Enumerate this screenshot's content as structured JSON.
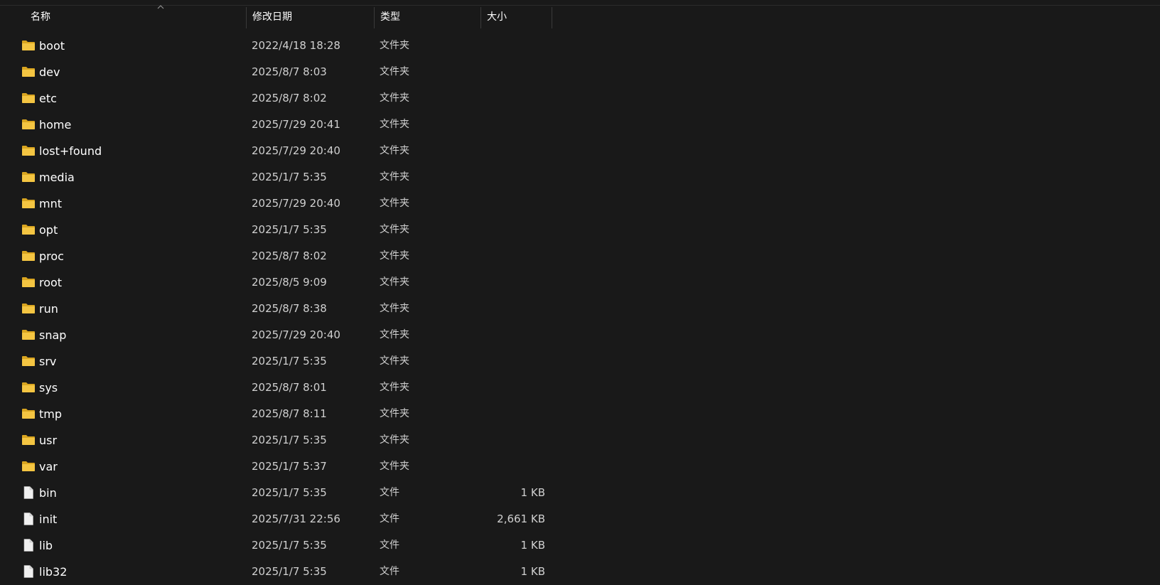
{
  "header": {
    "columns": [
      {
        "label": "名称",
        "sorted": "ascending"
      },
      {
        "label": "修改日期"
      },
      {
        "label": "类型"
      },
      {
        "label": "大小"
      }
    ]
  },
  "items": [
    {
      "name": "boot",
      "date": "2022/4/18 18:28",
      "type": "文件夹",
      "size": "",
      "icon": "folder-icon"
    },
    {
      "name": "dev",
      "date": "2025/8/7 8:03",
      "type": "文件夹",
      "size": "",
      "icon": "folder-icon"
    },
    {
      "name": "etc",
      "date": "2025/8/7 8:02",
      "type": "文件夹",
      "size": "",
      "icon": "folder-icon"
    },
    {
      "name": "home",
      "date": "2025/7/29 20:41",
      "type": "文件夹",
      "size": "",
      "icon": "folder-icon"
    },
    {
      "name": "lost+found",
      "date": "2025/7/29 20:40",
      "type": "文件夹",
      "size": "",
      "icon": "folder-icon"
    },
    {
      "name": "media",
      "date": "2025/1/7 5:35",
      "type": "文件夹",
      "size": "",
      "icon": "folder-icon"
    },
    {
      "name": "mnt",
      "date": "2025/7/29 20:40",
      "type": "文件夹",
      "size": "",
      "icon": "folder-icon"
    },
    {
      "name": "opt",
      "date": "2025/1/7 5:35",
      "type": "文件夹",
      "size": "",
      "icon": "folder-icon"
    },
    {
      "name": "proc",
      "date": "2025/8/7 8:02",
      "type": "文件夹",
      "size": "",
      "icon": "folder-icon"
    },
    {
      "name": "root",
      "date": "2025/8/5 9:09",
      "type": "文件夹",
      "size": "",
      "icon": "folder-icon"
    },
    {
      "name": "run",
      "date": "2025/8/7 8:38",
      "type": "文件夹",
      "size": "",
      "icon": "folder-icon"
    },
    {
      "name": "snap",
      "date": "2025/7/29 20:40",
      "type": "文件夹",
      "size": "",
      "icon": "folder-icon"
    },
    {
      "name": "srv",
      "date": "2025/1/7 5:35",
      "type": "文件夹",
      "size": "",
      "icon": "folder-icon"
    },
    {
      "name": "sys",
      "date": "2025/8/7 8:01",
      "type": "文件夹",
      "size": "",
      "icon": "folder-icon"
    },
    {
      "name": "tmp",
      "date": "2025/8/7 8:11",
      "type": "文件夹",
      "size": "",
      "icon": "folder-icon"
    },
    {
      "name": "usr",
      "date": "2025/1/7 5:35",
      "type": "文件夹",
      "size": "",
      "icon": "folder-icon"
    },
    {
      "name": "var",
      "date": "2025/1/7 5:37",
      "type": "文件夹",
      "size": "",
      "icon": "folder-icon"
    },
    {
      "name": "bin",
      "date": "2025/1/7 5:35",
      "type": "文件",
      "size": "1 KB",
      "icon": "file-icon"
    },
    {
      "name": "init",
      "date": "2025/7/31 22:56",
      "type": "文件",
      "size": "2,661 KB",
      "icon": "file-icon"
    },
    {
      "name": "lib",
      "date": "2025/1/7 5:35",
      "type": "文件",
      "size": "1 KB",
      "icon": "file-icon"
    },
    {
      "name": "lib32",
      "date": "2025/1/7 5:35",
      "type": "文件",
      "size": "1 KB",
      "icon": "file-icon"
    }
  ],
  "colors": {
    "background": "#191919",
    "folder": "#f4c542",
    "folder_dark": "#d9a520",
    "file": "#f0f0f0",
    "text": "#ffffff",
    "subtext": "#d0d0d0"
  }
}
